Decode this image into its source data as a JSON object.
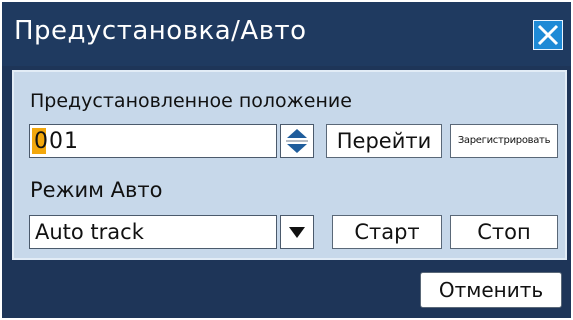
{
  "dialog": {
    "title": "Предустановка/Авто",
    "close_icon": "close-icon"
  },
  "preset": {
    "label": "Предустановленное положение",
    "value_highlight": "0",
    "value_rest": "01",
    "spinner_icon": "up-down-spinner-icon",
    "go_label": "Перейти",
    "register_label": "Зарегистрировать"
  },
  "auto": {
    "label": "Режим Авто",
    "mode_value": "Auto track",
    "dropdown_icon": "dropdown-arrow-icon",
    "start_label": "Старт",
    "stop_label": "Стоп"
  },
  "footer": {
    "cancel_label": "Отменить"
  },
  "colors": {
    "dialog_bg": "#1e3558",
    "panel_bg": "#c7d8ea",
    "close_button_bg": "#1e8ad6",
    "caret_highlight": "#f2a70c",
    "spinner_arrows": "#1f5d9c"
  }
}
